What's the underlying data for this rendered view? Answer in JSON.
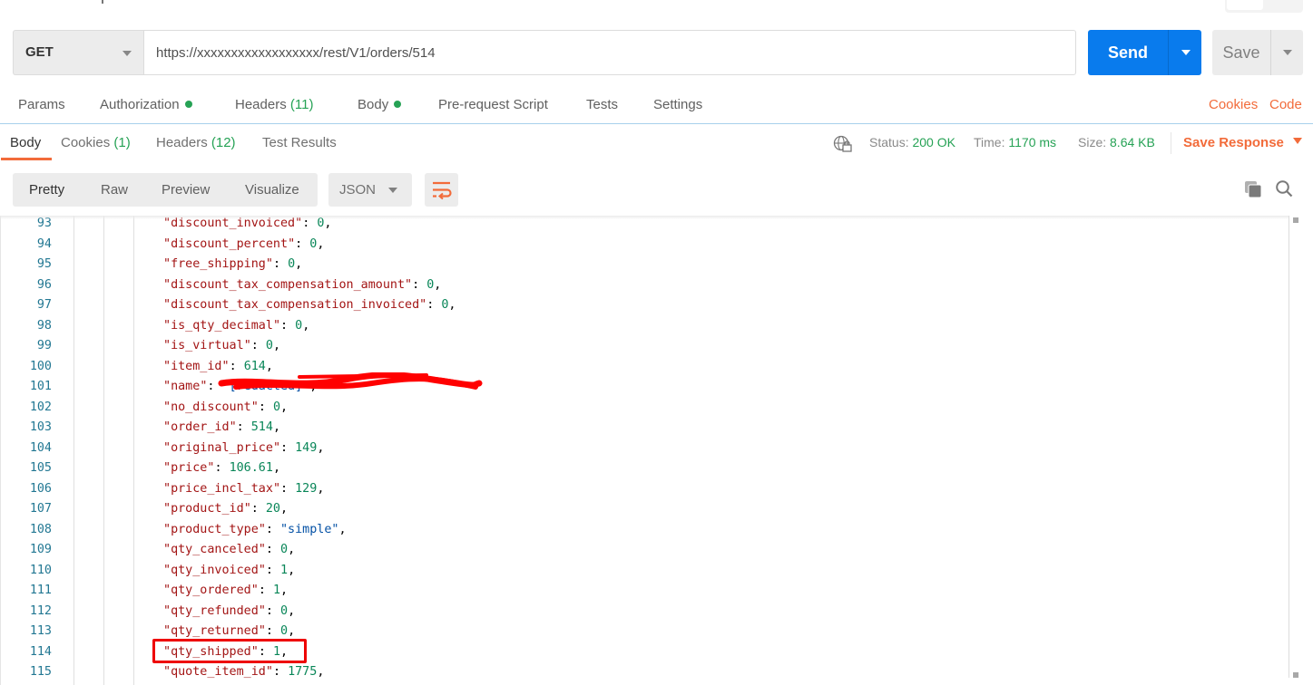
{
  "request": {
    "method": "GET",
    "url": "https://xxxxxxxxxxxxxxxxxx/rest/V1/orders/514",
    "send_label": "Send",
    "save_label": "Save"
  },
  "request_tabs": [
    {
      "label": "Params"
    },
    {
      "label": "Authorization",
      "dot": true
    },
    {
      "label": "Headers",
      "count": "(11)"
    },
    {
      "label": "Body",
      "dot": true
    },
    {
      "label": "Pre-request Script"
    },
    {
      "label": "Tests"
    },
    {
      "label": "Settings"
    }
  ],
  "request_links": {
    "cookies": "Cookies",
    "code": "Code"
  },
  "response_tabs": [
    {
      "label": "Body",
      "active": true
    },
    {
      "label": "Cookies",
      "count": "(1)"
    },
    {
      "label": "Headers",
      "count": "(12)"
    },
    {
      "label": "Test Results"
    }
  ],
  "response_status": {
    "status_label": "Status:",
    "status_value": "200 OK",
    "time_label": "Time:",
    "time_value": "1170 ms",
    "size_label": "Size:",
    "size_value": "8.64 KB",
    "save_response_label": "Save Response"
  },
  "view_modes": [
    "Pretty",
    "Raw",
    "Preview",
    "Visualize"
  ],
  "active_view_mode": "Pretty",
  "format": "JSON",
  "colors": {
    "accent_orange": "#f26b3a",
    "send_blue": "#097bed",
    "success_green": "#26a255",
    "highlight_red": "#ee0000"
  },
  "code_lines": [
    {
      "n": "93",
      "key": "discount_invoiced",
      "val": "0",
      "type": "num"
    },
    {
      "n": "94",
      "key": "discount_percent",
      "val": "0",
      "type": "num"
    },
    {
      "n": "95",
      "key": "free_shipping",
      "val": "0",
      "type": "num"
    },
    {
      "n": "96",
      "key": "discount_tax_compensation_amount",
      "val": "0",
      "type": "num"
    },
    {
      "n": "97",
      "key": "discount_tax_compensation_invoiced",
      "val": "0",
      "type": "num"
    },
    {
      "n": "98",
      "key": "is_qty_decimal",
      "val": "0",
      "type": "num"
    },
    {
      "n": "99",
      "key": "is_virtual",
      "val": "0",
      "type": "num"
    },
    {
      "n": "100",
      "key": "item_id",
      "val": "614",
      "type": "num"
    },
    {
      "n": "101",
      "key": "name",
      "val": "\"[redacted]\"",
      "type": "str",
      "redacted": true
    },
    {
      "n": "102",
      "key": "no_discount",
      "val": "0",
      "type": "num"
    },
    {
      "n": "103",
      "key": "order_id",
      "val": "514",
      "type": "num"
    },
    {
      "n": "104",
      "key": "original_price",
      "val": "149",
      "type": "num"
    },
    {
      "n": "105",
      "key": "price",
      "val": "106.61",
      "type": "num"
    },
    {
      "n": "106",
      "key": "price_incl_tax",
      "val": "129",
      "type": "num"
    },
    {
      "n": "107",
      "key": "product_id",
      "val": "20",
      "type": "num"
    },
    {
      "n": "108",
      "key": "product_type",
      "val": "\"simple\"",
      "type": "str"
    },
    {
      "n": "109",
      "key": "qty_canceled",
      "val": "0",
      "type": "num"
    },
    {
      "n": "110",
      "key": "qty_invoiced",
      "val": "1",
      "type": "num"
    },
    {
      "n": "111",
      "key": "qty_ordered",
      "val": "1",
      "type": "num"
    },
    {
      "n": "112",
      "key": "qty_refunded",
      "val": "0",
      "type": "num"
    },
    {
      "n": "113",
      "key": "qty_returned",
      "val": "0",
      "type": "num"
    },
    {
      "n": "114",
      "key": "qty_shipped",
      "val": "1",
      "type": "num",
      "highlighted": true
    },
    {
      "n": "115",
      "key": "quote_item_id",
      "val": "1775",
      "type": "num"
    }
  ]
}
